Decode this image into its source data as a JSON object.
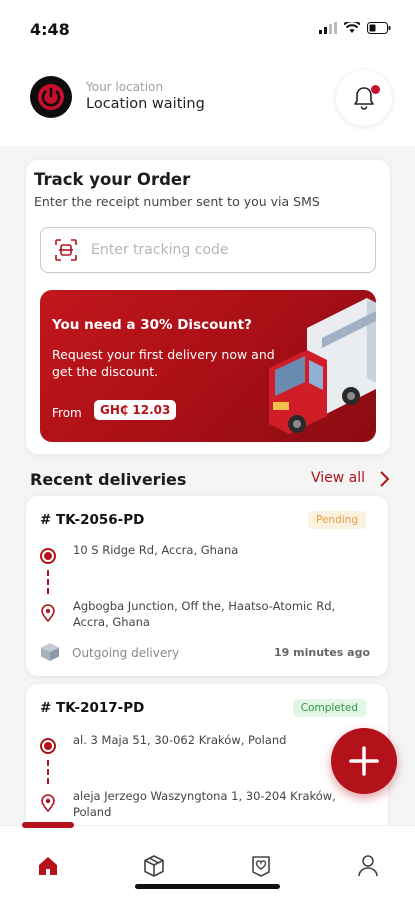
{
  "status_bar": {
    "time": "4:48"
  },
  "header": {
    "location_label": "Your location",
    "location_value": "Location waiting"
  },
  "track": {
    "title": "Track your Order",
    "subtitle": "Enter the receipt number sent to you via SMS",
    "input_placeholder": "Enter tracking code",
    "input_value": ""
  },
  "promo": {
    "title": "You need a 30% Discount?",
    "description": "Request your first delivery now and get the discount.",
    "from_label": "From",
    "price": "GH₵ 12.03"
  },
  "recent": {
    "title": "Recent deliveries",
    "view_all": "View all"
  },
  "deliveries": [
    {
      "id": "# TK-2056-PD",
      "status": "Pending",
      "pickup": "10 S Ridge Rd, Accra, Ghana",
      "dropoff": "Agbogba Junction, Off the, Haatso-Atomic Rd, Accra, Ghana",
      "type": "Outgoing delivery",
      "time": "19 minutes ago"
    },
    {
      "id": "# TK-2017-PD",
      "status": "Completed",
      "pickup": "al. 3 Maja 51, 30-062 Kraków, Poland",
      "dropoff": "aleja Jerzego Waszyngtona 1, 30-204 Kraków, Poland"
    }
  ],
  "nav": {
    "items": [
      {
        "name": "home",
        "icon": "home-icon",
        "active": true
      },
      {
        "name": "deliveries",
        "icon": "package-icon",
        "active": false
      },
      {
        "name": "favorites",
        "icon": "heart-badge-icon",
        "active": false
      },
      {
        "name": "profile",
        "icon": "user-icon",
        "active": false
      }
    ]
  },
  "colors": {
    "brand": "#b3121b",
    "pending": "#e0a040",
    "completed": "#2f9a44"
  }
}
